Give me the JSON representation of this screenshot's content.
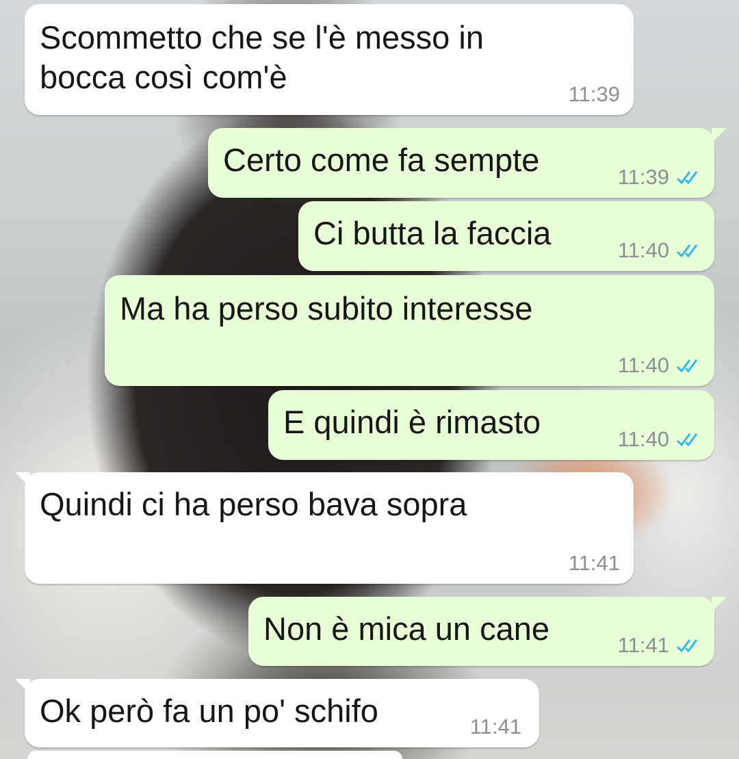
{
  "chat": {
    "messages": [
      {
        "text": "Scommetto che se l'è messo in\nbocca così com'è",
        "time": "11:39",
        "direction": "incoming"
      },
      {
        "text": "Certo come fa sempte",
        "time": "11:39",
        "direction": "outgoing",
        "status": "read"
      },
      {
        "text": "Ci butta la faccia",
        "time": "11:40",
        "direction": "outgoing",
        "status": "read"
      },
      {
        "text": "Ma ha perso subito interesse",
        "time": "11:40",
        "direction": "outgoing",
        "status": "read"
      },
      {
        "text": "E quindi è rimasto",
        "time": "11:40",
        "direction": "outgoing",
        "status": "read"
      },
      {
        "text": "Quindi ci ha perso bava sopra",
        "time": "11:41",
        "direction": "incoming"
      },
      {
        "text": "Non è mica un cane",
        "time": "11:41",
        "direction": "outgoing",
        "status": "read"
      },
      {
        "text": "Ok però fa un po' schifo",
        "time": "11:41",
        "direction": "incoming"
      }
    ]
  },
  "colors": {
    "incoming_bubble": "#ffffff",
    "outgoing_bubble": "#e7fed6",
    "read_ticks": "#34b7f1",
    "timestamp": "#8b8f92"
  },
  "icons": {
    "read_status": "double-check-icon"
  }
}
